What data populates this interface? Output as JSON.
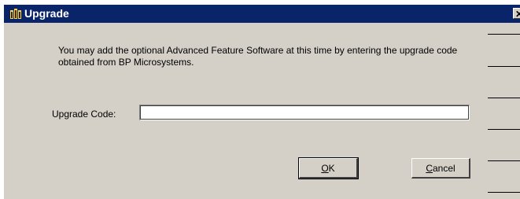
{
  "window": {
    "title": "Upgrade",
    "close_label": "✕"
  },
  "message": "You may add the optional Advanced Feature Software at this time by entering the upgrade code obtained from BP Microsystems.",
  "upgrade_code": {
    "label": "Upgrade Code:",
    "value": ""
  },
  "buttons": {
    "ok_mnemonic": "O",
    "ok_rest": "K",
    "cancel_mnemonic": "C",
    "cancel_rest": "ancel"
  },
  "icons": {
    "app_icon": "bp-microsystems-app-icon",
    "close": "close-icon"
  },
  "colors": {
    "titlebar": "#0a246a",
    "dialog_face": "#d4d0c8"
  }
}
